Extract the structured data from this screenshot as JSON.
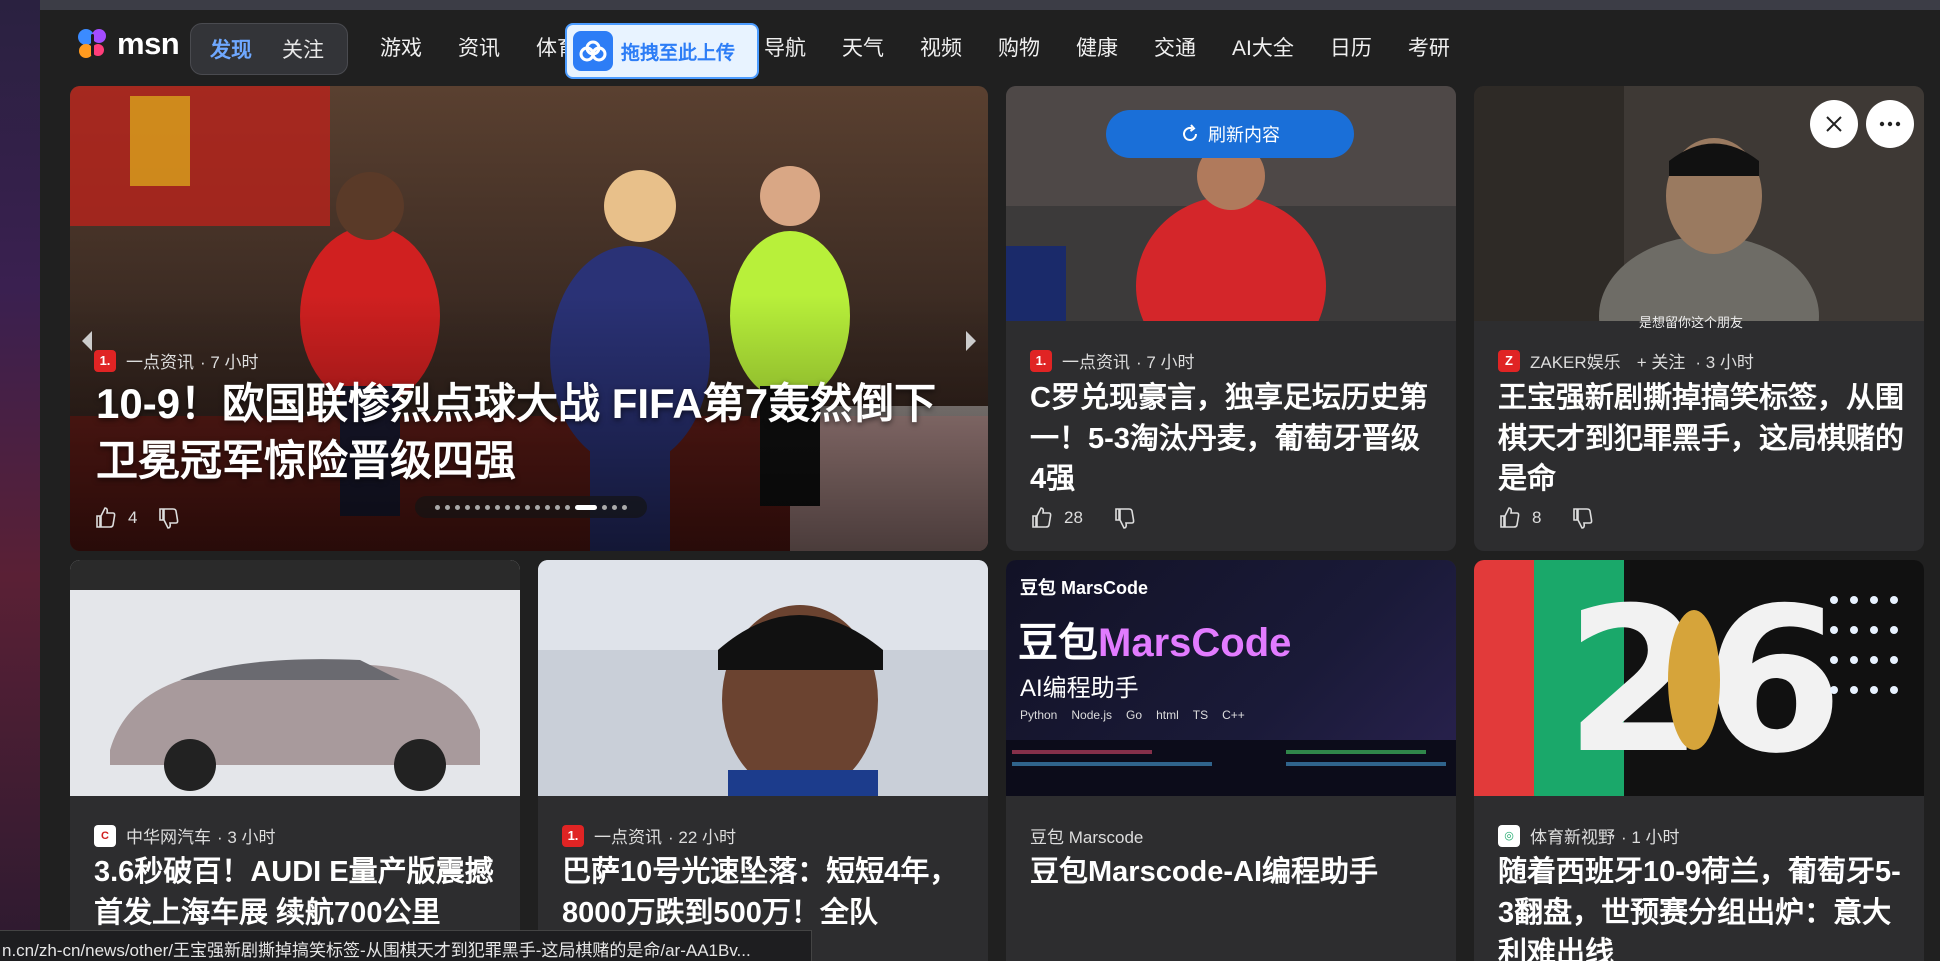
{
  "nav": {
    "logo_text": "msn",
    "pill_tabs": [
      "发现",
      "关注"
    ],
    "links": [
      "游戏",
      "资讯",
      "体育",
      "导航",
      "天气",
      "视频",
      "购物",
      "健康",
      "交通",
      "AI大全",
      "日历",
      "考研"
    ],
    "upload_overlay": "拖拽至此上传"
  },
  "hero": {
    "source": "一点资讯",
    "time": "· 7 小时",
    "headline": "10-9！欧国联惨烈点球大战 FIFA第7轰然倒下 卫冕冠军惊险晋级四强",
    "likes": "4"
  },
  "refresh_label": "刷新内容",
  "cards_top": [
    {
      "source": "一点资讯",
      "time": "· 7 小时",
      "headline": "C罗兑现豪言，独享足坛历史第一！5-3淘汰丹麦，葡萄牙晋级4强",
      "likes": "28"
    },
    {
      "source": "ZAKER娱乐",
      "follow": "+ 关注",
      "time": "· 3 小时",
      "headline": "王宝强新剧撕掉搞笑标签，从围棋天才到犯罪黑手，这局棋赌的是命",
      "likes": "8",
      "image_caption": "是想留你这个朋友"
    }
  ],
  "cards_bottom": [
    {
      "source": "中华网汽车",
      "time": "· 3 小时",
      "headline": "3.6秒破百！AUDI E量产版震撼首发上海车展 续航700公里"
    },
    {
      "source": "一点资讯",
      "time": "· 22 小时",
      "headline": "巴萨10号光速坠落：短短4年，8000万跌到500万！全队"
    },
    {
      "source": "豆包 Marscode",
      "time": "",
      "headline": "豆包Marscode-AI编程助手",
      "ad": {
        "brand": "豆包 MarsCode",
        "title_a": "豆包",
        "title_b": "MarsCode",
        "subtitle": "AI编程助手",
        "langs": [
          "Python",
          "Node.js",
          "Go",
          "html",
          "TS",
          "C++"
        ]
      }
    },
    {
      "source": "体育新视野",
      "time": "· 1 小时",
      "headline": "随着西班牙10-9荷兰，葡萄牙5-3翻盘，世预赛分组出炉：意大利难出线"
    }
  ],
  "status_url": "n.cn/zh-cn/news/other/王宝强新剧撕掉搞笑标签-从围棋天才到犯罪黑手-这局棋赌的是命/ar-AA1Bv...",
  "colors": {
    "accent": "#1a6fd8",
    "card_bg": "#2d2d2f",
    "page_bg": "#202020"
  }
}
